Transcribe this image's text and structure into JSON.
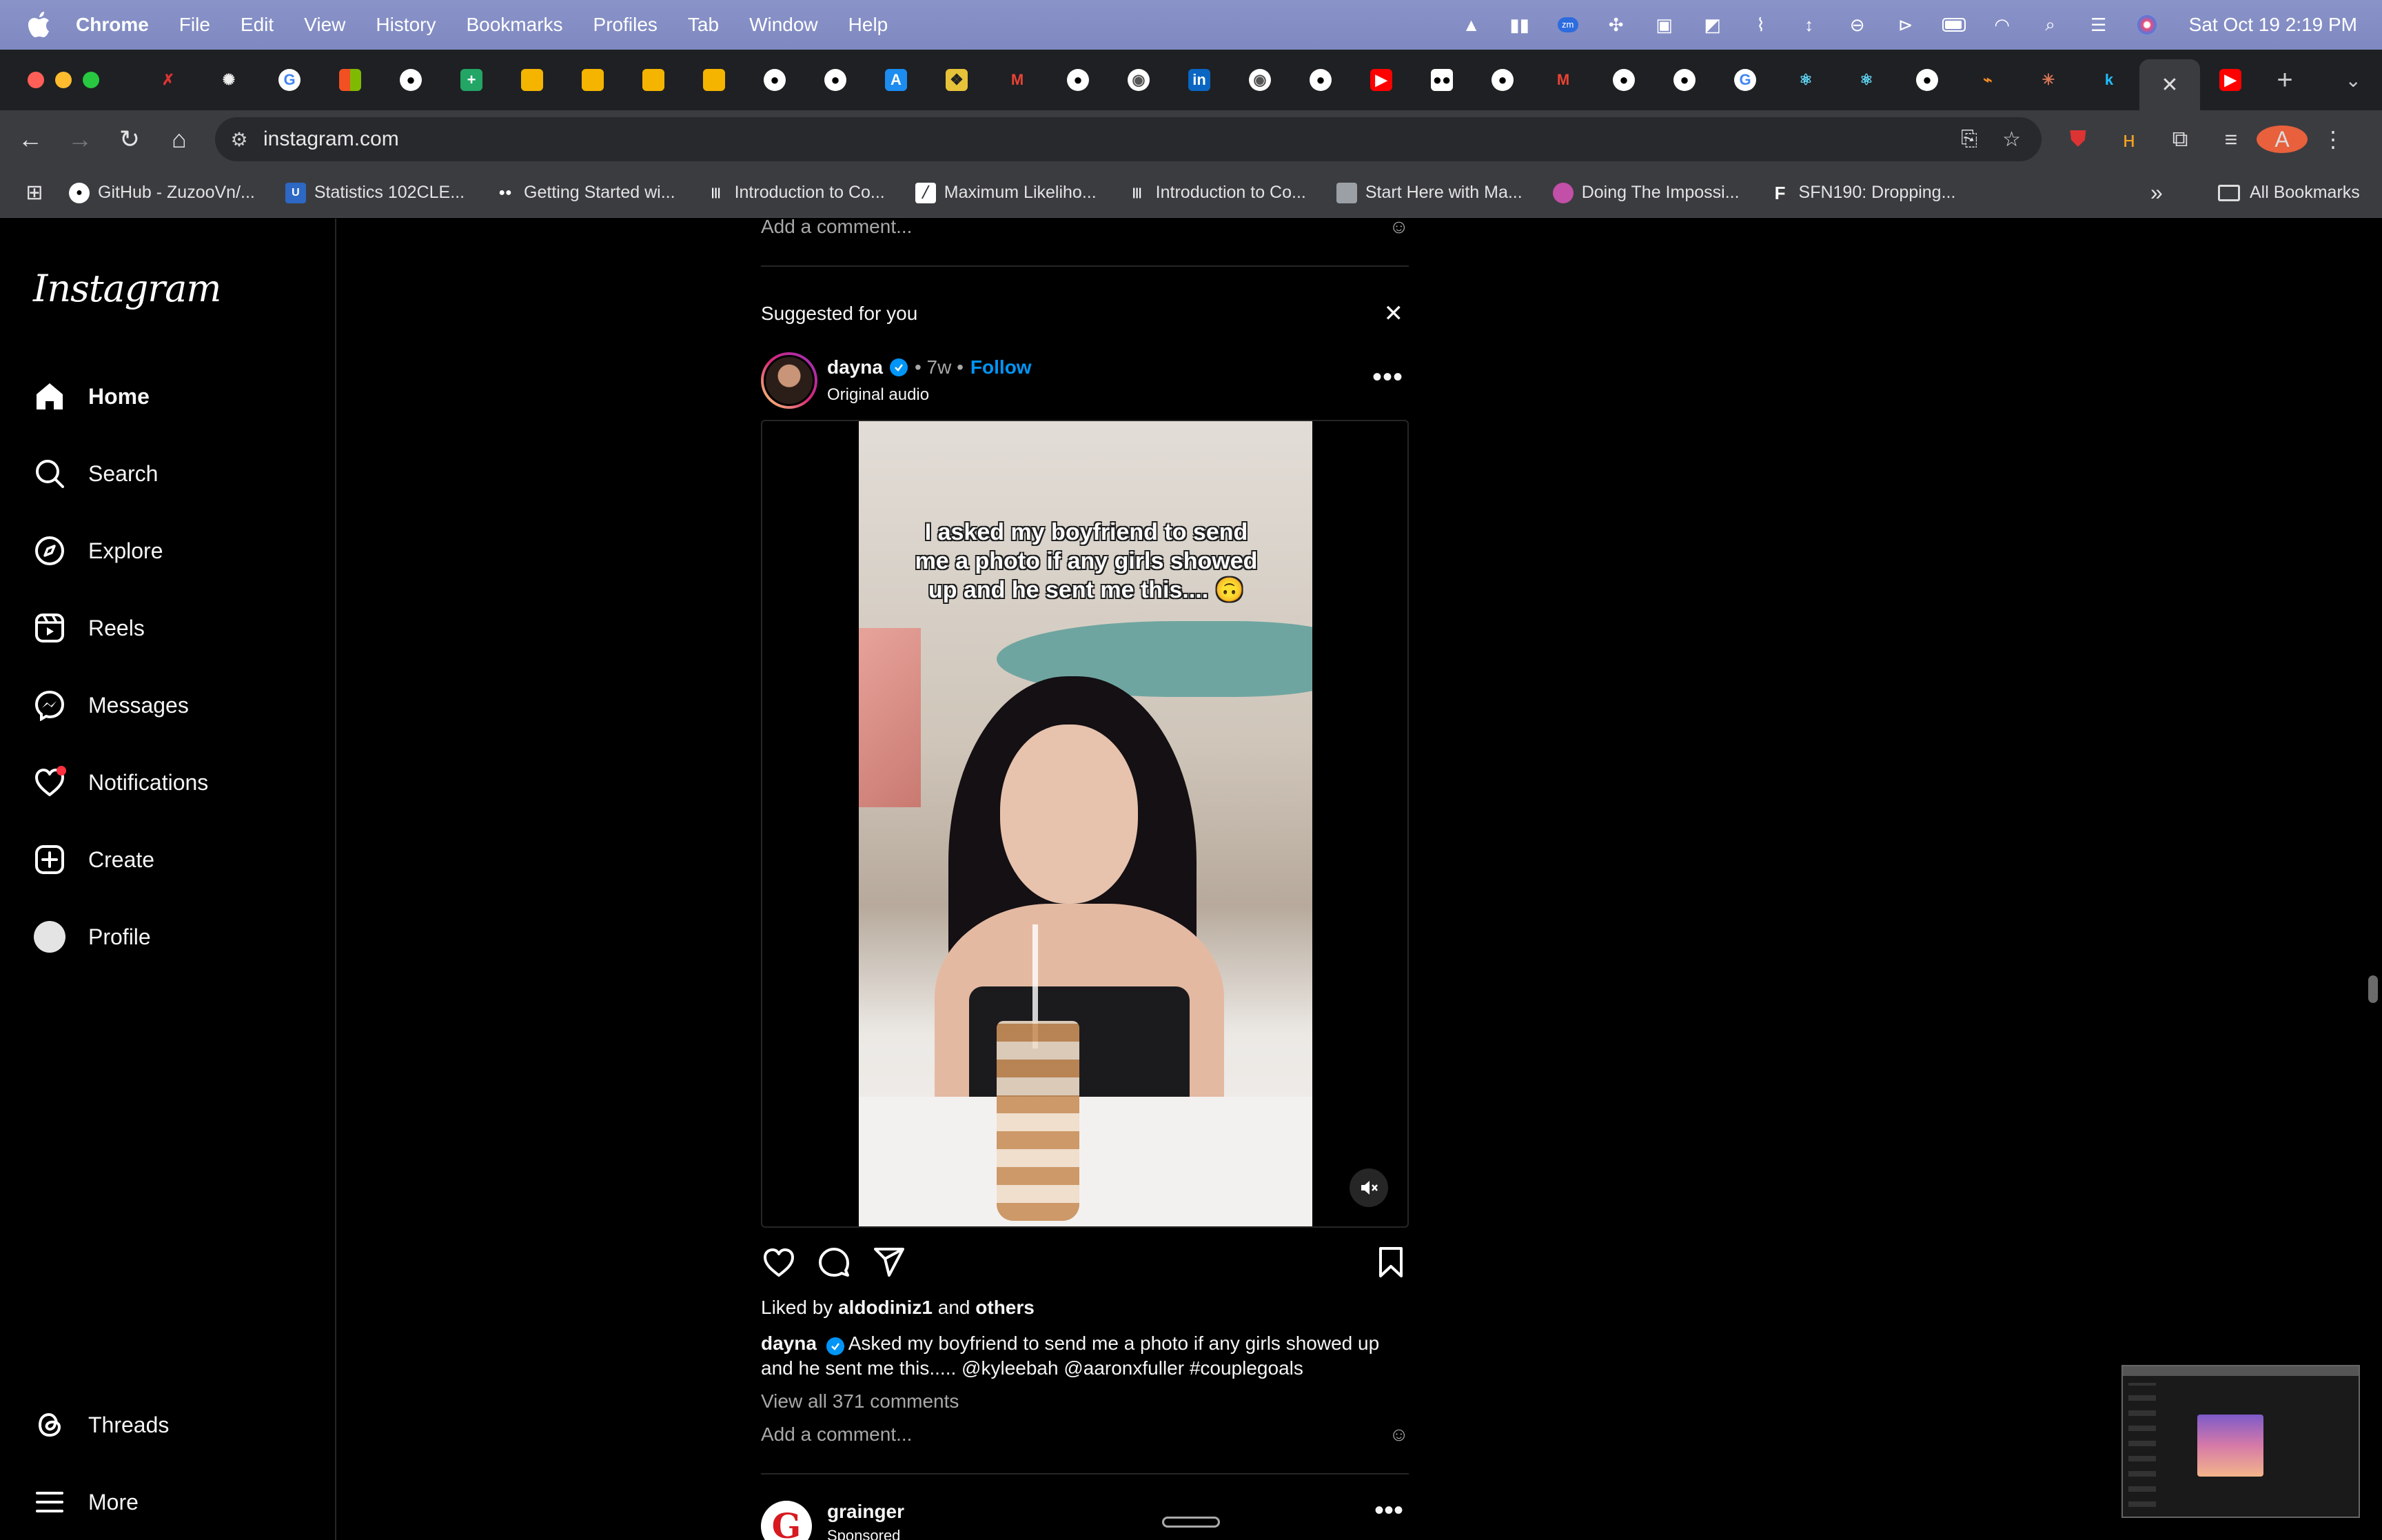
{
  "menubar": {
    "app_name": "Chrome",
    "menus": [
      "File",
      "Edit",
      "View",
      "History",
      "Bookmarks",
      "Profiles",
      "Tab",
      "Window",
      "Help"
    ],
    "clock": "Sat Oct 19  2:19 PM"
  },
  "tabs": {
    "favicons": [
      "x-icon",
      "openai-icon",
      "google-icon",
      "microsoft-icon",
      "github-icon",
      "sheets-icon",
      "slides-icon",
      "slides-icon",
      "slides-icon",
      "slides-icon",
      "github-icon",
      "github-icon",
      "appstore-icon",
      "notion-icon",
      "gmail-icon",
      "github-icon",
      "chrome-icon",
      "linkedin-icon",
      "chrome-icon",
      "github-icon",
      "youtube-icon",
      "medium-icon",
      "github-icon",
      "gmail-icon",
      "github-icon",
      "github-icon",
      "google-icon",
      "react-icon",
      "react-icon",
      "github-icon",
      "overleaf-icon",
      "claude-icon",
      "kaggle-icon"
    ],
    "active_tab_icon": "close-icon",
    "after_active": "youtube-icon"
  },
  "toolbar": {
    "url": "instagram.com"
  },
  "bookmarks": [
    {
      "label": "GitHub - ZuzooVn/...",
      "icon": "github-icon",
      "color": "#ffffff"
    },
    {
      "label": "Statistics 102CLE...",
      "icon": "ucla-icon",
      "color": "#2d68c4"
    },
    {
      "label": "Getting Started wi...",
      "icon": "medium-icon",
      "color": "#ffffff"
    },
    {
      "label": "Introduction to Co...",
      "icon": "coursera-icon",
      "color": "#ffffff"
    },
    {
      "label": "Maximum Likeliho...",
      "icon": "doc-icon",
      "color": "#ffffff"
    },
    {
      "label": "Introduction to Co...",
      "icon": "coursera-icon",
      "color": "#ffffff"
    },
    {
      "label": "Start Here with Ma...",
      "icon": "image-icon",
      "color": "#9aa0a6"
    },
    {
      "label": "Doing The Impossi...",
      "icon": "circle-icon",
      "color": "#c24fa8"
    },
    {
      "label": "SFN190: Dropping...",
      "icon": "f-icon",
      "color": "#ffffff"
    }
  ],
  "all_bookmarks": "All Bookmarks",
  "instagram": {
    "logo": "Instagram",
    "nav": [
      {
        "label": "Home",
        "icon": "home-icon"
      },
      {
        "label": "Search",
        "icon": "search-icon"
      },
      {
        "label": "Explore",
        "icon": "compass-icon"
      },
      {
        "label": "Reels",
        "icon": "reels-icon"
      },
      {
        "label": "Messages",
        "icon": "messenger-icon"
      },
      {
        "label": "Notifications",
        "icon": "heart-icon"
      },
      {
        "label": "Create",
        "icon": "plus-square-icon"
      },
      {
        "label": "Profile",
        "icon": "avatar"
      }
    ],
    "bottom_nav": [
      {
        "label": "Threads",
        "icon": "threads-icon"
      },
      {
        "label": "More",
        "icon": "menu-icon"
      }
    ]
  },
  "feed": {
    "add_comment": "Add a comment...",
    "suggested_label": "Suggested for you",
    "post": {
      "username": "dayna",
      "time": "7w",
      "follow": "Follow",
      "audio": "Original audio",
      "overlay_text": "I asked my boyfriend to send me a photo if any girls showed up and he sent me this.... 🙃",
      "likes_prefix": "Liked by",
      "likes_user": "aldodiniz1",
      "likes_and": "and",
      "likes_others": "others",
      "caption_user": "dayna",
      "caption_text": "Asked my boyfriend to send me a photo if any girls showed up and he sent me this..... @kyleebah @aaronxfuller #couplegoals",
      "view_comments": "View all 371 comments",
      "add_comment": "Add a comment..."
    },
    "next_post": {
      "username": "grainger",
      "subtitle": "Sponsored",
      "avatar_letter": "G"
    }
  },
  "colors": {
    "accent": "#0095f6",
    "notification_dot": "#ff3040"
  }
}
